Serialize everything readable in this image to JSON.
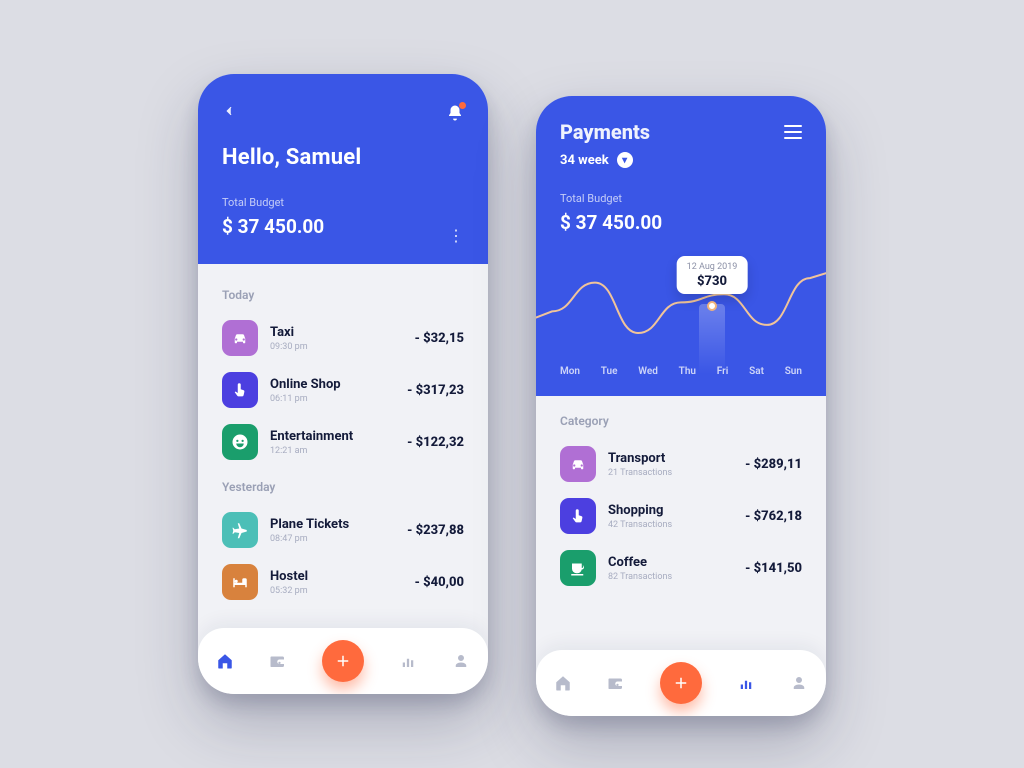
{
  "screen1": {
    "greeting": "Hello, Samuel",
    "budget_label": "Total Budget",
    "budget_value": "$ 37 450.00",
    "sections": {
      "today_label": "Today",
      "yesterday_label": "Yesterday"
    },
    "today": [
      {
        "name": "Taxi",
        "sub": "09:30 pm",
        "amount": "- $32,15",
        "icon": "car",
        "color": "c-purple"
      },
      {
        "name": "Online Shop",
        "sub": "06:11 pm",
        "amount": "- $317,23",
        "icon": "tap",
        "color": "c-blue"
      },
      {
        "name": "Entertainment",
        "sub": "12:21 am",
        "amount": "- $122,32",
        "icon": "smile",
        "color": "c-green"
      }
    ],
    "yesterday": [
      {
        "name": "Plane Tickets",
        "sub": "08:47 pm",
        "amount": "- $237,88",
        "icon": "plane",
        "color": "c-teal"
      },
      {
        "name": "Hostel",
        "sub": "05:32 pm",
        "amount": "- $40,00",
        "icon": "bed",
        "color": "c-orange"
      }
    ]
  },
  "screen2": {
    "title": "Payments",
    "week_label": "34 week",
    "budget_label": "Total Budget",
    "budget_value": "$ 37 450.00",
    "tooltip_date": "12 Aug 2019",
    "tooltip_value": "$730",
    "days": [
      "Mon",
      "Tue",
      "Wed",
      "Thu",
      "Fri",
      "Sat",
      "Sun"
    ],
    "category_label": "Category",
    "categories": [
      {
        "name": "Transport",
        "sub": "21 Transactions",
        "amount": "- $289,11",
        "icon": "car",
        "color": "c-purple"
      },
      {
        "name": "Shopping",
        "sub": "42 Transactions",
        "amount": "- $762,18",
        "icon": "tap",
        "color": "c-blue"
      },
      {
        "name": "Coffee",
        "sub": "82 Transactions",
        "amount": "- $141,50",
        "icon": "cup",
        "color": "c-green"
      }
    ]
  },
  "chart_data": {
    "type": "line",
    "title": "Payments, 34 week",
    "xlabel": "",
    "ylabel": "",
    "categories": [
      "Mon",
      "Tue",
      "Wed",
      "Thu",
      "Fri",
      "Sat",
      "Sun"
    ],
    "values": [
      540,
      860,
      300,
      640,
      730,
      390,
      910
    ],
    "highlight": {
      "index": 4,
      "label": "12 Aug 2019",
      "value": 730
    },
    "ylim": [
      0,
      1000
    ]
  }
}
